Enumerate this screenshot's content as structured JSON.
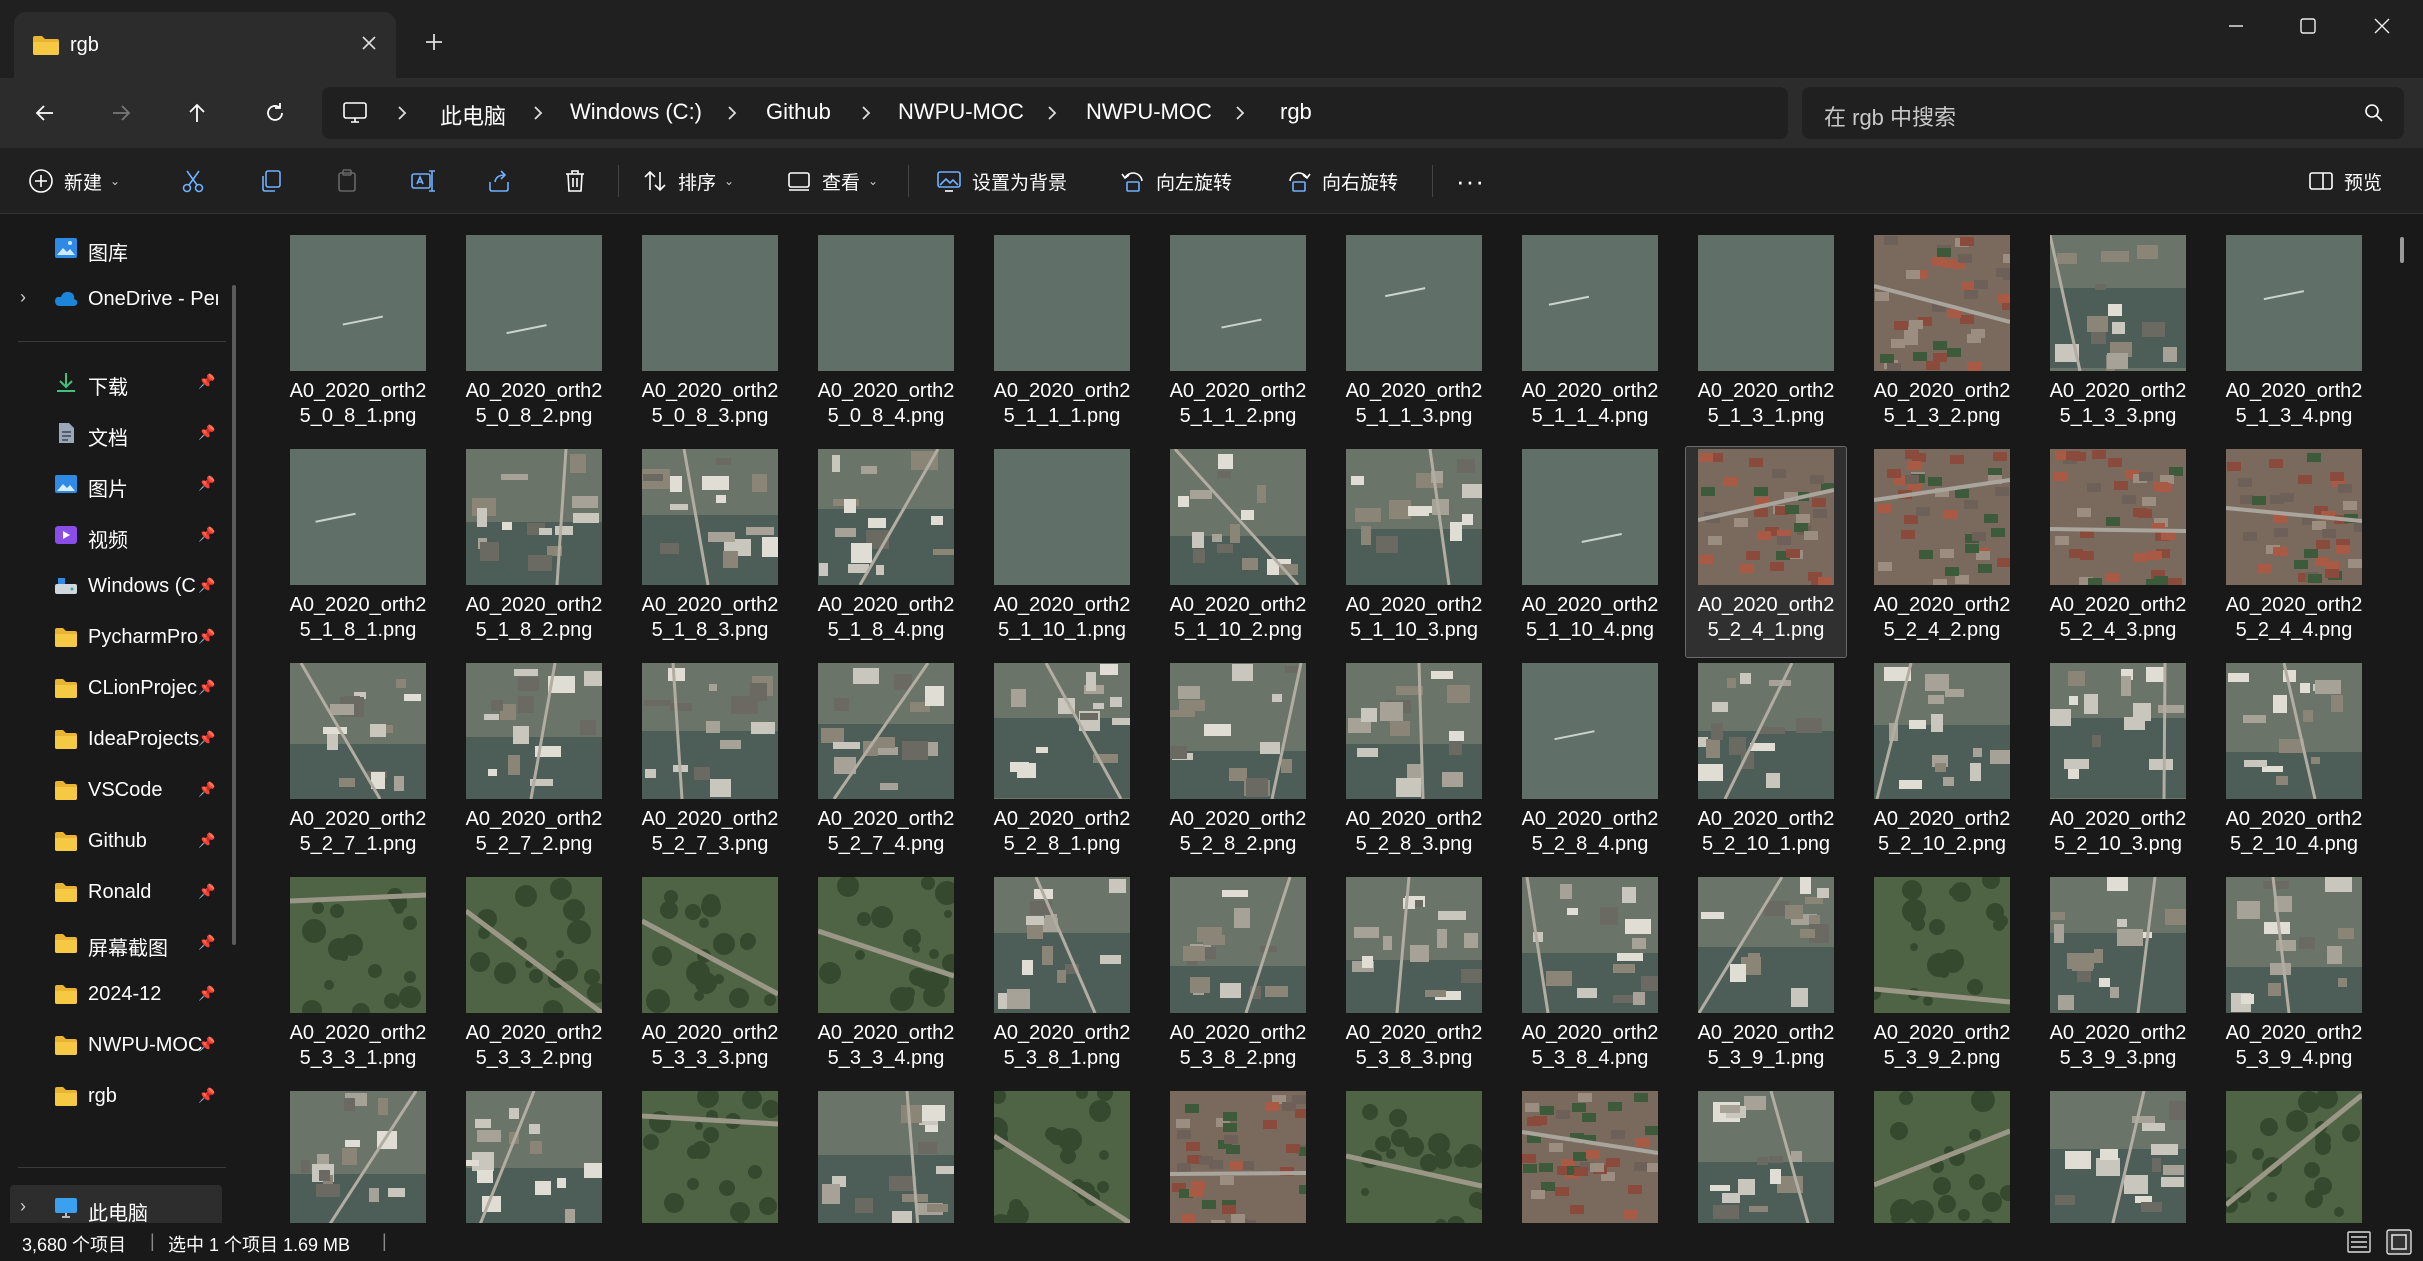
{
  "window": {
    "tab_title": "rgb",
    "icons": {
      "folder": "folder-icon",
      "close": "close-icon",
      "new_tab": "plus-icon",
      "minimize": "minimize-icon",
      "maximize": "maximize-icon",
      "window_close": "close-window-icon"
    }
  },
  "nav": {
    "breadcrumbs": [
      "此电脑",
      "Windows (C:)",
      "Github",
      "NWPU-MOC",
      "NWPU-MOC",
      "rgb"
    ],
    "search_placeholder": "在 rgb 中搜索"
  },
  "toolbar": {
    "new_label": "新建",
    "sort_label": "排序",
    "view_label": "查看",
    "set_background_label": "设置为背景",
    "rotate_left_label": "向左旋转",
    "rotate_right_label": "向右旋转",
    "more_label": "···",
    "preview_label": "预览"
  },
  "sidebar": {
    "top_items": [
      {
        "label": "图库",
        "icon": "gallery-icon"
      },
      {
        "label": "OneDrive - Per",
        "icon": "cloud-icon"
      }
    ],
    "quick_access": [
      {
        "label": "下载",
        "icon": "download-icon"
      },
      {
        "label": "文档",
        "icon": "document-icon"
      },
      {
        "label": "图片",
        "icon": "pictures-icon"
      },
      {
        "label": "视频",
        "icon": "video-icon"
      },
      {
        "label": "Windows (C",
        "icon": "drive-icon"
      },
      {
        "label": "PycharmPro",
        "icon": "folder-icon"
      },
      {
        "label": "CLionProjec",
        "icon": "folder-icon"
      },
      {
        "label": "IdeaProjects",
        "icon": "folder-icon"
      },
      {
        "label": "VSCode",
        "icon": "folder-icon"
      },
      {
        "label": "Github",
        "icon": "folder-icon"
      },
      {
        "label": "Ronald",
        "icon": "folder-icon"
      },
      {
        "label": "屏幕截图",
        "icon": "folder-icon"
      },
      {
        "label": "2024-12",
        "icon": "folder-icon"
      },
      {
        "label": "NWPU-MOC",
        "icon": "folder-icon"
      },
      {
        "label": "rgb",
        "icon": "folder-icon"
      }
    ],
    "this_pc_label": "此电脑"
  },
  "files": [
    [
      "A0_2020_orth2",
      "5_0_8_1.png"
    ],
    [
      "A0_2020_orth2",
      "5_0_8_2.png"
    ],
    [
      "A0_2020_orth2",
      "5_0_8_3.png"
    ],
    [
      "A0_2020_orth2",
      "5_0_8_4.png"
    ],
    [
      "A0_2020_orth2",
      "5_1_1_1.png"
    ],
    [
      "A0_2020_orth2",
      "5_1_1_2.png"
    ],
    [
      "A0_2020_orth2",
      "5_1_1_3.png"
    ],
    [
      "A0_2020_orth2",
      "5_1_1_4.png"
    ],
    [
      "A0_2020_orth2",
      "5_1_3_1.png"
    ],
    [
      "A0_2020_orth2",
      "5_1_3_2.png"
    ],
    [
      "A0_2020_orth2",
      "5_1_3_3.png"
    ],
    [
      "A0_2020_orth2",
      "5_1_3_4.png"
    ],
    [
      "A0_2020_orth2",
      "5_1_8_1.png"
    ],
    [
      "A0_2020_orth2",
      "5_1_8_2.png"
    ],
    [
      "A0_2020_orth2",
      "5_1_8_3.png"
    ],
    [
      "A0_2020_orth2",
      "5_1_8_4.png"
    ],
    [
      "A0_2020_orth2",
      "5_1_10_1.png"
    ],
    [
      "A0_2020_orth2",
      "5_1_10_2.png"
    ],
    [
      "A0_2020_orth2",
      "5_1_10_3.png"
    ],
    [
      "A0_2020_orth2",
      "5_1_10_4.png"
    ],
    [
      "A0_2020_orth2",
      "5_2_4_1.png"
    ],
    [
      "A0_2020_orth2",
      "5_2_4_2.png"
    ],
    [
      "A0_2020_orth2",
      "5_2_4_3.png"
    ],
    [
      "A0_2020_orth2",
      "5_2_4_4.png"
    ],
    [
      "A0_2020_orth2",
      "5_2_7_1.png"
    ],
    [
      "A0_2020_orth2",
      "5_2_7_2.png"
    ],
    [
      "A0_2020_orth2",
      "5_2_7_3.png"
    ],
    [
      "A0_2020_orth2",
      "5_2_7_4.png"
    ],
    [
      "A0_2020_orth2",
      "5_2_8_1.png"
    ],
    [
      "A0_2020_orth2",
      "5_2_8_2.png"
    ],
    [
      "A0_2020_orth2",
      "5_2_8_3.png"
    ],
    [
      "A0_2020_orth2",
      "5_2_8_4.png"
    ],
    [
      "A0_2020_orth2",
      "5_2_10_1.png"
    ],
    [
      "A0_2020_orth2",
      "5_2_10_2.png"
    ],
    [
      "A0_2020_orth2",
      "5_2_10_3.png"
    ],
    [
      "A0_2020_orth2",
      "5_2_10_4.png"
    ],
    [
      "A0_2020_orth2",
      "5_3_3_1.png"
    ],
    [
      "A0_2020_orth2",
      "5_3_3_2.png"
    ],
    [
      "A0_2020_orth2",
      "5_3_3_3.png"
    ],
    [
      "A0_2020_orth2",
      "5_3_3_4.png"
    ],
    [
      "A0_2020_orth2",
      "5_3_8_1.png"
    ],
    [
      "A0_2020_orth2",
      "5_3_8_2.png"
    ],
    [
      "A0_2020_orth2",
      "5_3_8_3.png"
    ],
    [
      "A0_2020_orth2",
      "5_3_8_4.png"
    ],
    [
      "A0_2020_orth2",
      "5_3_9_1.png"
    ],
    [
      "A0_2020_orth2",
      "5_3_9_2.png"
    ],
    [
      "A0_2020_orth2",
      "5_3_9_3.png"
    ],
    [
      "A0_2020_orth2",
      "5_3_9_4.png"
    ]
  ],
  "selected_file": "5_2_4_1.png",
  "thumb_palettes": {
    "water": "#5f6e66",
    "harbor": "#6b7468",
    "urban": "#7a6a5e",
    "green": "#55654a"
  },
  "thumb_kinds": [
    "water",
    "water",
    "water",
    "water",
    "water",
    "water",
    "water",
    "water",
    "water",
    "urban",
    "harbor",
    "water",
    "water",
    "harbor",
    "harbor",
    "harbor",
    "water",
    "harbor",
    "harbor",
    "water",
    "urban",
    "urban",
    "urban",
    "urban",
    "harbor",
    "harbor",
    "harbor",
    "harbor",
    "harbor",
    "harbor",
    "harbor",
    "water",
    "harbor",
    "harbor",
    "harbor",
    "harbor",
    "green",
    "green",
    "green",
    "green",
    "harbor",
    "harbor",
    "harbor",
    "harbor",
    "harbor",
    "green",
    "harbor",
    "harbor",
    "harbor",
    "harbor",
    "green",
    "harbor",
    "green",
    "urban",
    "green",
    "urban",
    "harbor",
    "green",
    "harbor",
    "green"
  ],
  "status": {
    "item_count": "3,680 个项目",
    "selection": "选中 1 个项目  1.69 MB",
    "separator": "|"
  }
}
